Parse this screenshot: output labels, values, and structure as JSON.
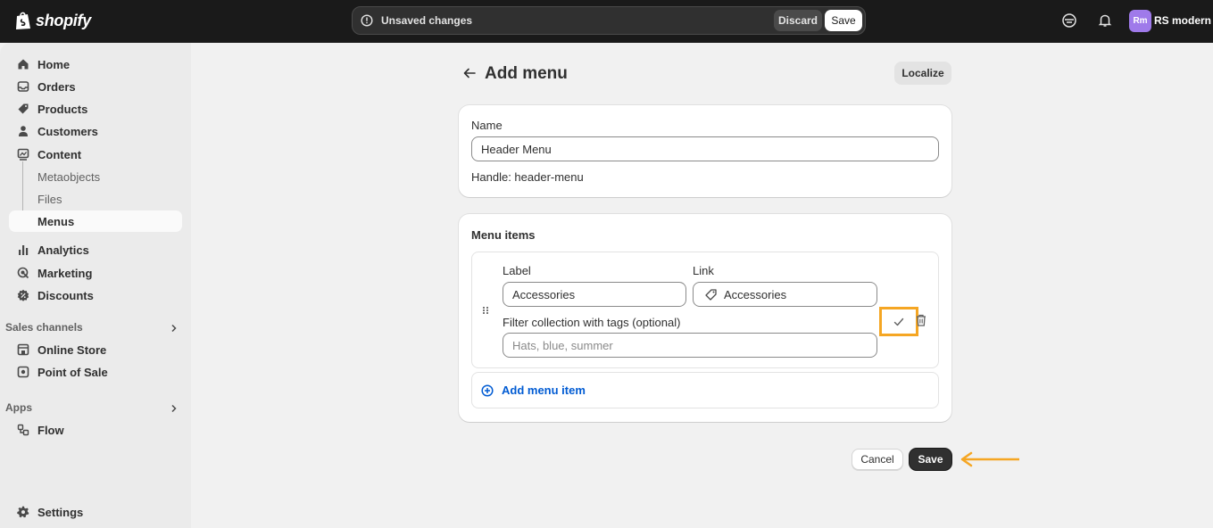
{
  "brand": {
    "name": "shopify"
  },
  "save_bar": {
    "message": "Unsaved changes",
    "discard_label": "Discard",
    "save_label": "Save"
  },
  "header": {
    "avatar_initials": "Rm",
    "store_name": "RS modern",
    "avatar_color": "#9f7aea"
  },
  "sidebar": {
    "items": [
      {
        "label": "Home",
        "icon": "home-icon"
      },
      {
        "label": "Orders",
        "icon": "inbox-icon"
      },
      {
        "label": "Products",
        "icon": "tag-icon"
      },
      {
        "label": "Customers",
        "icon": "person-icon"
      },
      {
        "label": "Content",
        "icon": "content-icon"
      },
      {
        "label": "Metaobjects"
      },
      {
        "label": "Files"
      },
      {
        "label": "Menus",
        "active": true
      },
      {
        "label": "Analytics",
        "icon": "bar-chart-icon"
      },
      {
        "label": "Marketing",
        "icon": "target-icon"
      },
      {
        "label": "Discounts",
        "icon": "discount-icon"
      }
    ],
    "sales_channels": {
      "heading": "Sales channels",
      "items": [
        {
          "label": "Online Store",
          "icon": "store-icon"
        },
        {
          "label": "Point of Sale",
          "icon": "pos-icon"
        }
      ]
    },
    "apps": {
      "heading": "Apps",
      "items": [
        {
          "label": "Flow",
          "icon": "flow-icon"
        }
      ]
    },
    "settings_label": "Settings"
  },
  "page": {
    "title": "Add menu",
    "localize_label": "Localize"
  },
  "name_card": {
    "label": "Name",
    "value": "Header Menu",
    "handle": "Handle: header-menu"
  },
  "menu_items_card": {
    "title": "Menu items",
    "item": {
      "label_heading": "Label",
      "label_value": "Accessories",
      "link_heading": "Link",
      "link_value": "Accessories",
      "filter_heading": "Filter collection with tags (optional)",
      "filter_placeholder": "Hats, blue, summer"
    },
    "add_label": "Add menu item"
  },
  "footer": {
    "cancel_label": "Cancel",
    "save_label": "Save"
  },
  "colors": {
    "accent_link": "#005bd3",
    "highlight": "#f5a623",
    "topbar": "#1a1a1a"
  }
}
